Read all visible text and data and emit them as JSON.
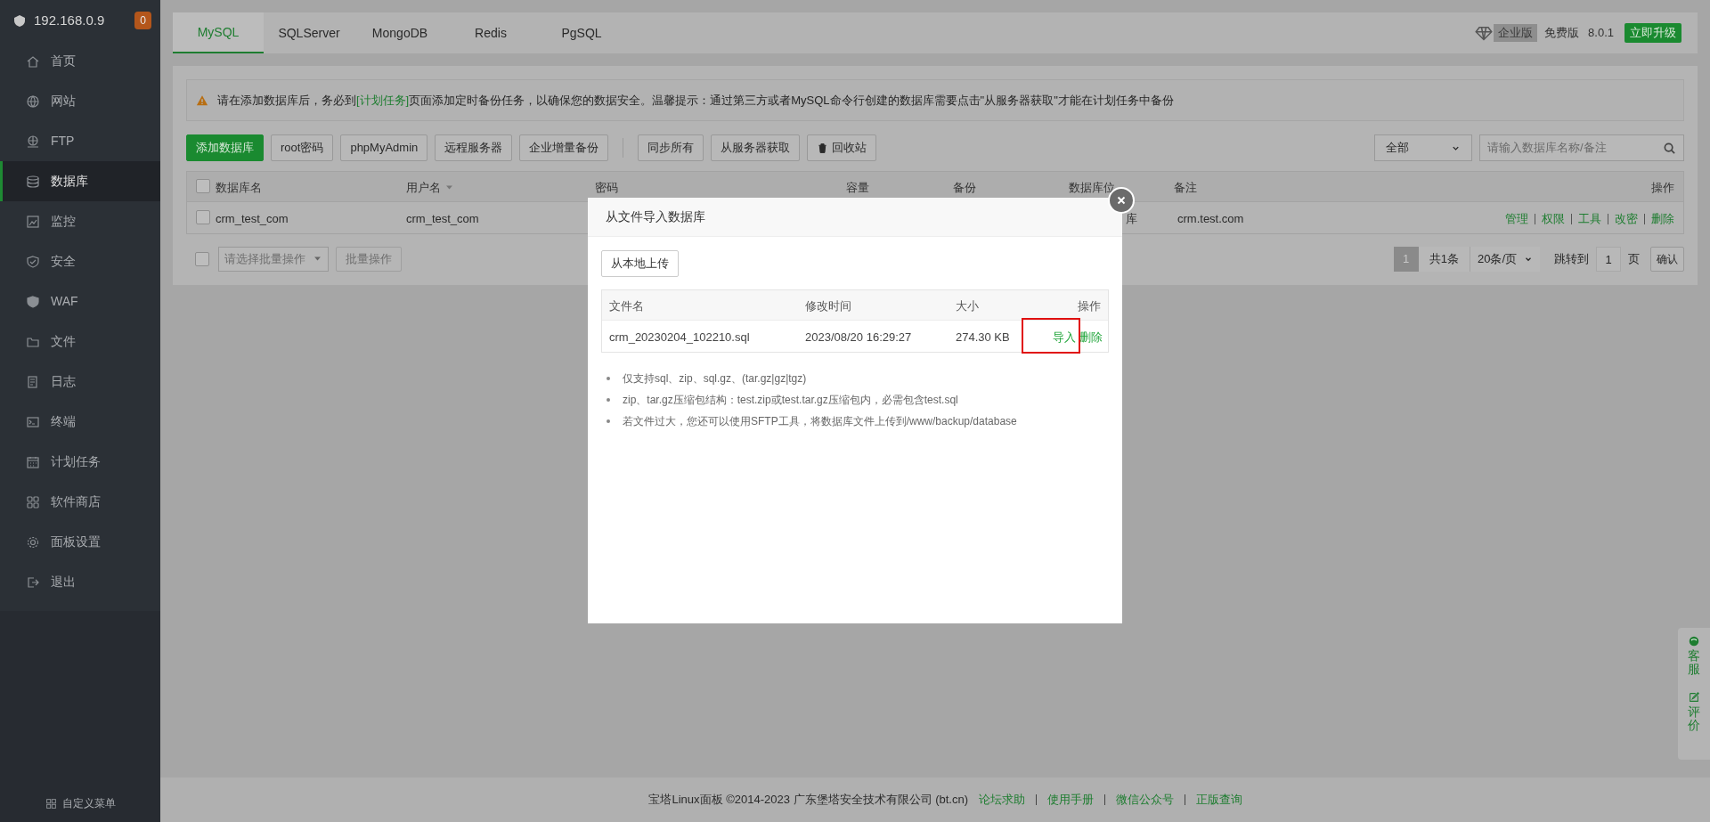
{
  "sidebar": {
    "host": "192.168.0.9",
    "badge": "0",
    "items": [
      {
        "label": "首页",
        "selected": false
      },
      {
        "label": "网站",
        "selected": false
      },
      {
        "label": "FTP",
        "selected": false
      },
      {
        "label": "数据库",
        "selected": true
      },
      {
        "label": "监控",
        "selected": false
      },
      {
        "label": "安全",
        "selected": false
      },
      {
        "label": "WAF",
        "selected": false
      },
      {
        "label": "文件",
        "selected": false
      },
      {
        "label": "日志",
        "selected": false
      },
      {
        "label": "终端",
        "selected": false
      },
      {
        "label": "计划任务",
        "selected": false
      },
      {
        "label": "软件商店",
        "selected": false
      },
      {
        "label": "面板设置",
        "selected": false
      },
      {
        "label": "退出",
        "selected": false
      }
    ],
    "custom_menu": "自定义菜单"
  },
  "tabs": [
    {
      "label": "MySQL",
      "selected": true
    },
    {
      "label": "SQLServer",
      "selected": false
    },
    {
      "label": "MongoDB",
      "selected": false
    },
    {
      "label": "Redis",
      "selected": false
    },
    {
      "label": "PgSQL",
      "selected": false
    }
  ],
  "edition": {
    "badge": "企业版",
    "plan": "免费版",
    "version": "8.0.1",
    "upgrade": "立即升级"
  },
  "notice": {
    "before": "请在添加数据库后，务必到",
    "link": "[计划任务]",
    "after": "页面添加定时备份任务，以确保您的数据安全。温馨提示：通过第三方或者MySQL命令行创建的数据库需要点击\"从服务器获取\"才能在计划任务中备份"
  },
  "toolbar_left": [
    {
      "label": "添加数据库",
      "kind": "primary"
    },
    {
      "label": "root密码",
      "kind": "plain"
    },
    {
      "label": "phpMyAdmin",
      "kind": "plain"
    },
    {
      "label": "远程服务器",
      "kind": "plain"
    },
    {
      "label": "企业增量备份",
      "kind": "plain"
    }
  ],
  "toolbar_right": [
    {
      "label": "同步所有",
      "kind": "plain"
    },
    {
      "label": "从服务器获取",
      "kind": "plain"
    },
    {
      "label": "回收站",
      "kind": "trash"
    }
  ],
  "filter": {
    "select": "全部",
    "search_placeholder": "请输入数据库名称/备注"
  },
  "table": {
    "select_all": {
      "checked": false
    },
    "columns": [
      {
        "label": "数据库名",
        "sortable": false
      },
      {
        "label": "用户名",
        "sortable": true
      },
      {
        "label": "密码",
        "sortable": false
      },
      {
        "label": "容量",
        "sortable": false
      },
      {
        "label": "备份",
        "sortable": false
      },
      {
        "label": "数据库位",
        "sortable": false
      },
      {
        "label": "备注",
        "sortable": false
      },
      {
        "label": "操作",
        "sortable": false
      }
    ],
    "rows": [
      {
        "checked": false,
        "name": "crm_test_com",
        "user": "crm_test_com",
        "location": "库",
        "remark": "crm.test.com",
        "actions": [
          "管理",
          "权限",
          "工具",
          "改密",
          "删除"
        ]
      }
    ]
  },
  "batch": {
    "checked": false,
    "select_placeholder": "请选择批量操作",
    "button": "批量操作"
  },
  "pagination": {
    "pages": [
      {
        "label": "1",
        "selected": true
      }
    ],
    "total": "共1条",
    "per_page": "20条/页",
    "jump_label": "跳转到",
    "jump_value": "1",
    "page_unit": "页",
    "confirm": "确认"
  },
  "modal": {
    "title": "从文件导入数据库",
    "upload": "从本地上传",
    "columns": [
      "文件名",
      "修改时间",
      "大小",
      "操作"
    ],
    "rows": [
      {
        "name": "crm_20230204_102210.sql",
        "mtime": "2023/08/20 16:29:27",
        "size": "274.30 KB",
        "actions": [
          {
            "label": "导入",
            "highlighted": true
          },
          {
            "label": "删除",
            "highlighted": false
          }
        ]
      }
    ],
    "notes": [
      "仅支持sql、zip、sql.gz、(tar.gz|gz|tgz)",
      "zip、tar.gz压缩包结构：test.zip或test.tar.gz压缩包内，必需包含test.sql",
      "若文件过大，您还可以使用SFTP工具，将数据库文件上传到/www/backup/database"
    ]
  },
  "footer": {
    "text": "宝塔Linux面板 ©2014-2023 广东堡塔安全技术有限公司 (bt.cn)",
    "links": [
      "论坛求助",
      "使用手册",
      "微信公众号",
      "正版查询"
    ]
  },
  "float_buttons": [
    "客服",
    "评价"
  ]
}
